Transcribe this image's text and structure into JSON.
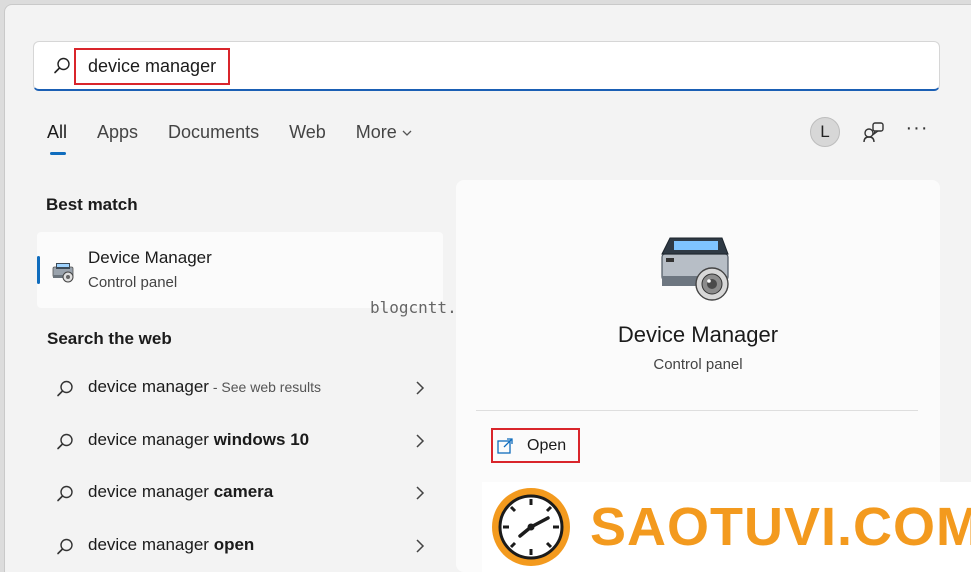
{
  "search": {
    "query": "device manager"
  },
  "tabs": [
    {
      "label": "All",
      "active": true
    },
    {
      "label": "Apps"
    },
    {
      "label": "Documents"
    },
    {
      "label": "Web"
    },
    {
      "label": "More"
    }
  ],
  "header": {
    "avatar_initial": "L",
    "more_icon": "more-dots-icon",
    "feedback_icon": "feedback-icon"
  },
  "best_match": {
    "title": "Best match",
    "name": "Device Manager",
    "subtitle": "Control panel"
  },
  "web": {
    "title": "Search the web",
    "results": [
      {
        "prefix": "device manager",
        "bold": "",
        "suffix": " - See web results"
      },
      {
        "prefix": "device manager ",
        "bold": "windows 10",
        "suffix": ""
      },
      {
        "prefix": "device manager ",
        "bold": "camera",
        "suffix": ""
      },
      {
        "prefix": "device manager ",
        "bold": "open",
        "suffix": ""
      }
    ]
  },
  "watermark": "blogcntt.com",
  "detail": {
    "name": "Device Manager",
    "subtitle": "Control panel",
    "open_label": "Open"
  },
  "logo": {
    "text": "SAOTUVI.COM"
  },
  "colors": {
    "accent": "#0f6cbd",
    "highlight_box": "#d9252b",
    "brand": "#f39a1e"
  }
}
